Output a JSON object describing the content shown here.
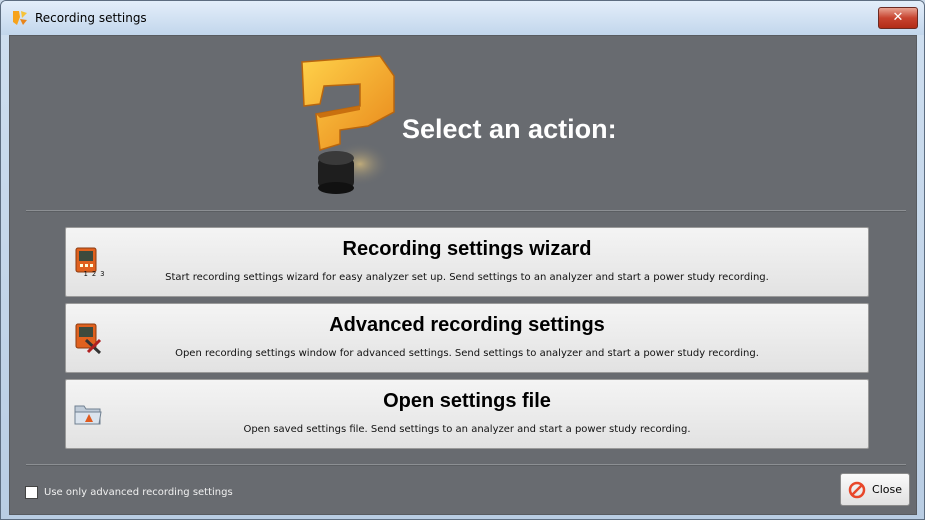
{
  "window": {
    "title": "Recording settings"
  },
  "header": {
    "title": "Select an action:"
  },
  "actions": [
    {
      "title": "Recording settings wizard",
      "description": "Start recording settings wizard for easy analyzer set up. Send settings to an analyzer and start a power study recording.",
      "icon": "analyzer-wizard-icon",
      "icon_caption": "1 2 3"
    },
    {
      "title": "Advanced recording settings",
      "description": "Open recording settings window for advanced settings. Send settings to analyzer and start a power study recording.",
      "icon": "analyzer-tools-icon"
    },
    {
      "title": "Open settings file",
      "description": "Open saved settings file. Send settings to an analyzer and start a power study recording.",
      "icon": "open-folder-icon"
    }
  ],
  "footer": {
    "checkbox_label": "Use only advanced recording settings",
    "checkbox_checked": false,
    "close_label": "Close"
  },
  "colors": {
    "panel_bg": "#686b70",
    "hero_text": "#ffffff",
    "accent_orange": "#f5a623",
    "close_icon_red": "#e8472a"
  }
}
